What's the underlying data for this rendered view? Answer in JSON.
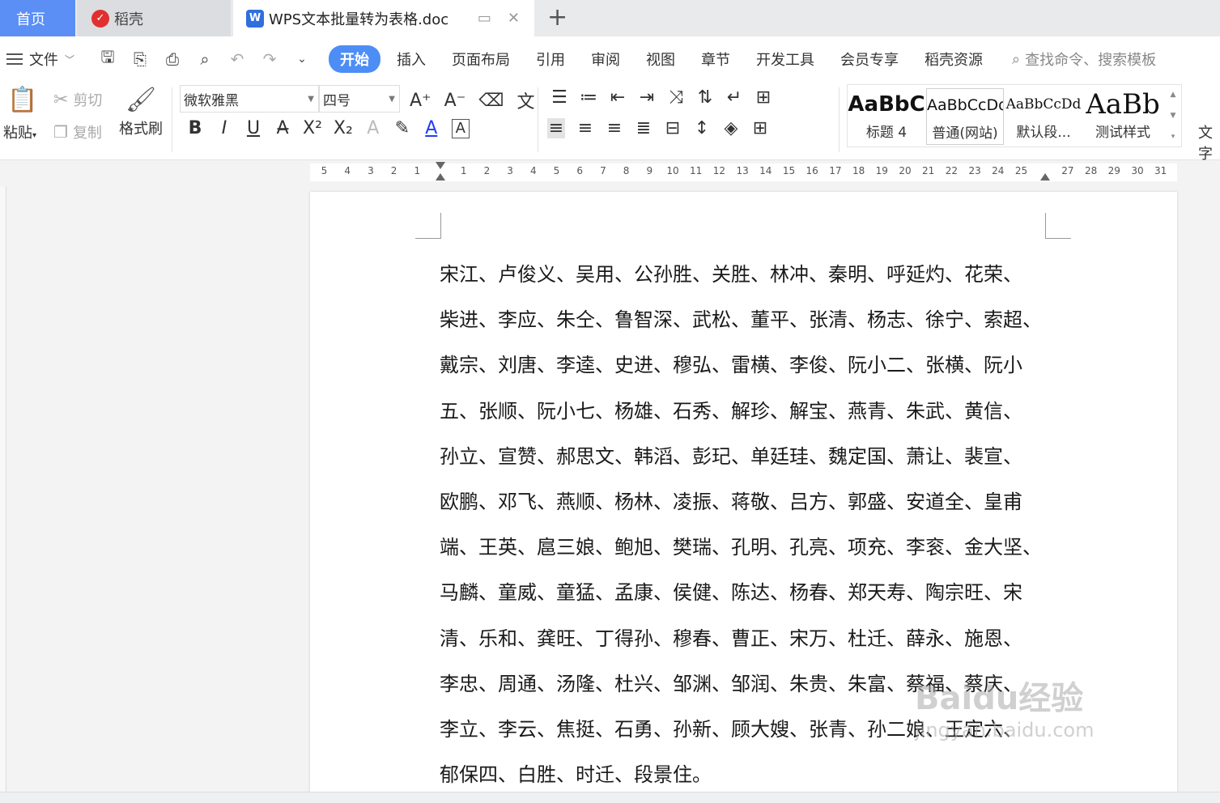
{
  "tabs": {
    "home": "首页",
    "daoke": "稻壳",
    "doc": "WPS文本批量转为表格.doc"
  },
  "menubar": {
    "file": "文件",
    "items": [
      "开始",
      "插入",
      "页面布局",
      "引用",
      "审阅",
      "视图",
      "章节",
      "开发工具",
      "会员专享",
      "稻壳资源"
    ],
    "search_placeholder": "查找命令、搜索模板"
  },
  "ribbon": {
    "paste": "粘贴",
    "cut": "剪切",
    "copy": "复制",
    "format_painter": "格式刷",
    "font_name": "微软雅黑",
    "font_size": "四号",
    "styles": [
      {
        "sample": "AaBbC",
        "label": "标题 4"
      },
      {
        "sample": "AaBbCcDd",
        "label": "普通(网站)"
      },
      {
        "sample": "AaBbCcDd",
        "label": "默认段..."
      },
      {
        "sample": "AaBb",
        "label": "测试样式"
      }
    ],
    "more": "文字"
  },
  "ruler": {
    "left_numbers": [
      "5",
      "4",
      "3",
      "2",
      "1"
    ],
    "right_numbers": [
      "1",
      "2",
      "3",
      "4",
      "5",
      "6",
      "7",
      "8",
      "9",
      "10",
      "11",
      "12",
      "13",
      "14",
      "15",
      "16",
      "17",
      "18",
      "19",
      "20",
      "21",
      "22",
      "23",
      "24",
      "25",
      "27",
      "28",
      "29",
      "30",
      "31"
    ]
  },
  "document": {
    "lines": [
      "宋江、卢俊义、吴用、公孙胜、关胜、林冲、秦明、呼延灼、花荣、",
      "柴进、李应、朱仝、鲁智深、武松、董平、张清、杨志、徐宁、索超、",
      "戴宗、刘唐、李逵、史进、穆弘、雷横、李俊、阮小二、张横、阮小",
      "五、张顺、阮小七、杨雄、石秀、解珍、解宝、燕青、朱武、黄信、",
      "孙立、宣赞、郝思文、韩滔、彭玘、单廷珪、魏定国、萧让、裴宣、",
      "欧鹏、邓飞、燕顺、杨林、凌振、蒋敬、吕方、郭盛、安道全、皇甫",
      "端、王英、扈三娘、鲍旭、樊瑞、孔明、孔亮、项充、李衮、金大坚、",
      "马麟、童威、童猛、孟康、侯健、陈达、杨春、郑天寿、陶宗旺、宋",
      "清、乐和、龚旺、丁得孙、穆春、曹正、宋万、杜迁、薛永、施恩、",
      "李忠、周通、汤隆、杜兴、邹渊、邹润、朱贵、朱富、蔡福、蔡庆、",
      "李立、李云、焦挺、石勇、孙新、顾大嫂、张青、孙二娘、王定六、",
      "郁保四、白胜、时迁、段景住。"
    ]
  },
  "watermark": {
    "brand": "Baidu经验",
    "url": "jingyan.baidu.com"
  },
  "colors": {
    "accent": "#4c8ef5",
    "home_tab": "#5b8ff5"
  }
}
